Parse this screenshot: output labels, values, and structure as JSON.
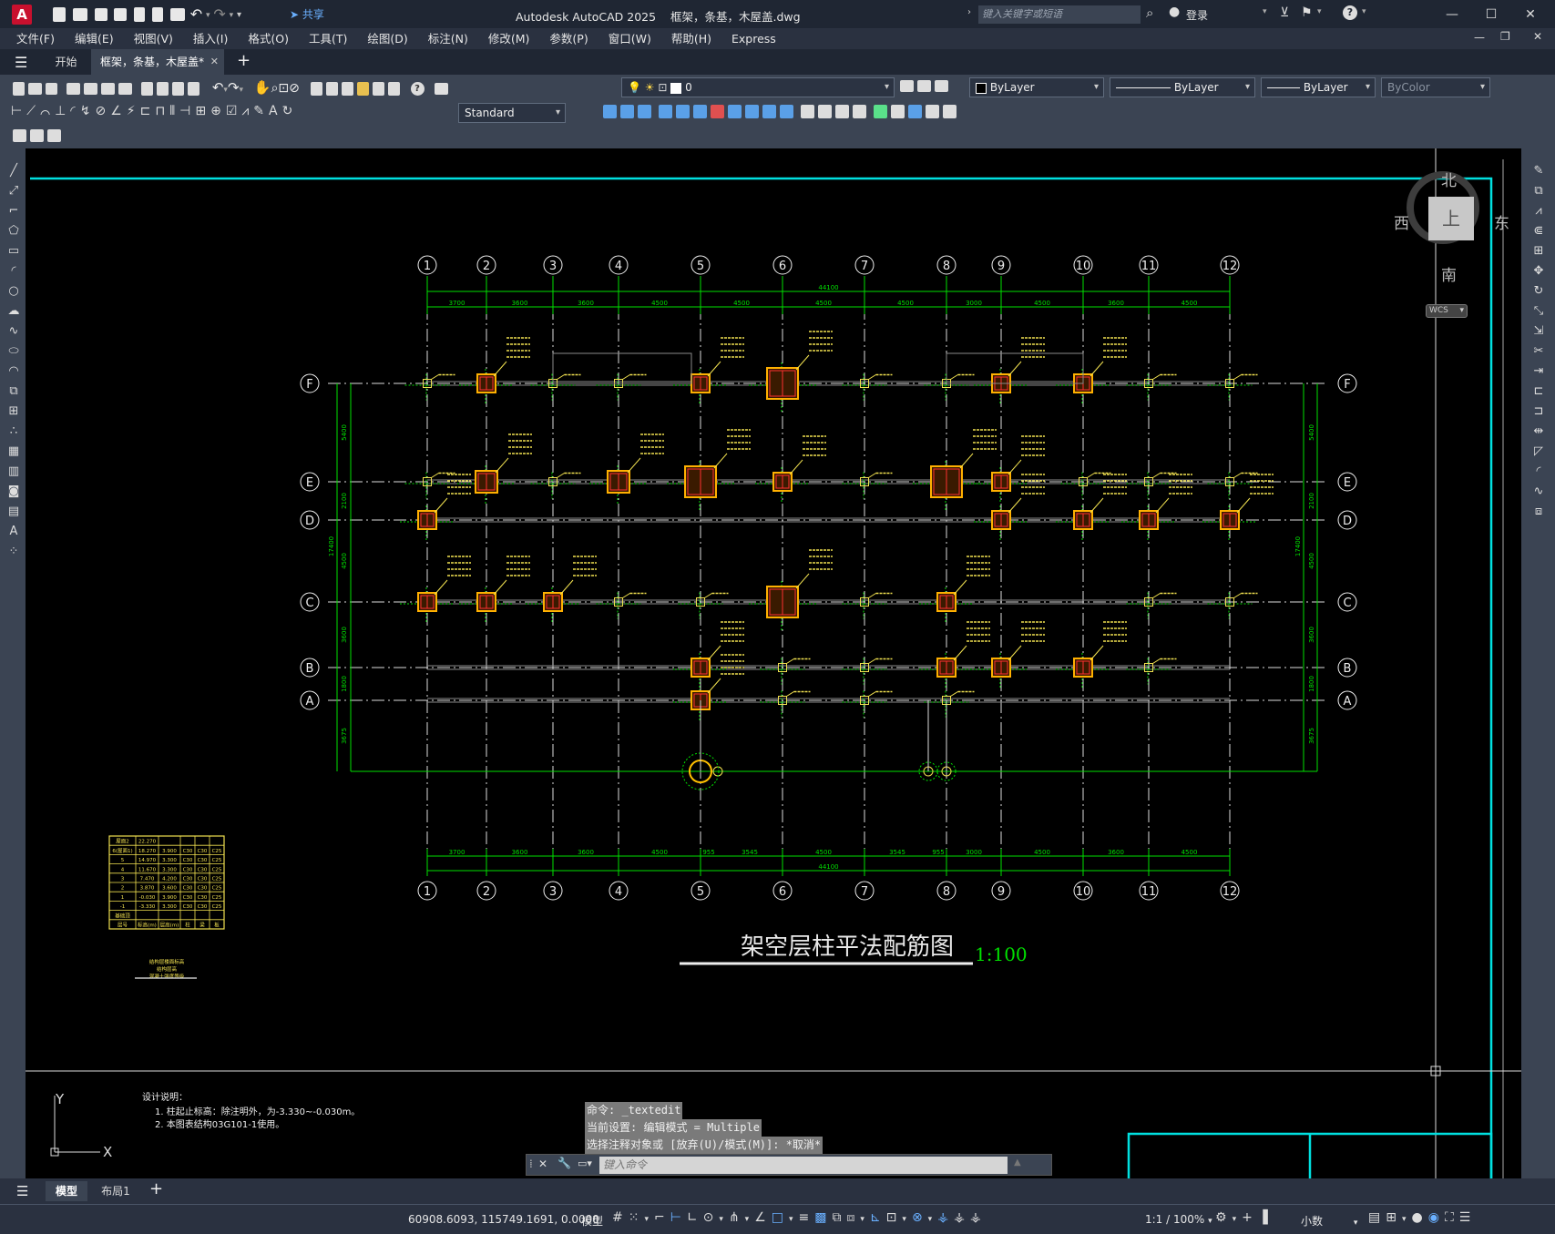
{
  "app": {
    "title": "Autodesk AutoCAD 2025    框架，条基，木屋盖.dwg",
    "search_placeholder": "键入关键字或短语",
    "login": "登录",
    "share": "共享",
    "logo": "A"
  },
  "menu": [
    "文件(F)",
    "编辑(E)",
    "视图(V)",
    "插入(I)",
    "格式(O)",
    "工具(T)",
    "绘图(D)",
    "标注(N)",
    "修改(M)",
    "参数(P)",
    "窗口(W)",
    "帮助(H)",
    "Express"
  ],
  "tabs": {
    "start": "开始",
    "active": "框架，条基，木屋盖*",
    "add": "+"
  },
  "toolbar": {
    "layer_value": "0",
    "color": "ByLayer",
    "linetype": "ByLayer",
    "lineweight": "ByLayer",
    "plotstyle": "ByColor",
    "dimstyle": "Standard"
  },
  "viewcube": {
    "north": "北",
    "south": "南",
    "east": "东",
    "west": "西",
    "face": "上",
    "wcs": "WCS"
  },
  "drawing": {
    "title": "架空层柱平法配筋图",
    "scale": "1:100",
    "grid_numbers": [
      "1",
      "2",
      "3",
      "4",
      "5",
      "6",
      "7",
      "8",
      "9",
      "10",
      "11",
      "12"
    ],
    "grid_letters": [
      "F",
      "E",
      "D",
      "C",
      "B",
      "A"
    ],
    "top_overall": "44100",
    "top_dims": [
      "3700",
      "3600",
      "3600",
      "4500",
      "4500",
      "4500",
      "4500",
      "3000",
      "4500",
      "3600",
      "4500"
    ],
    "bottom_dims": [
      "3700",
      "3600",
      "3600",
      "4500",
      "955",
      "3545",
      "4500",
      "3545",
      "955",
      "3000",
      "4500",
      "3600",
      "4500"
    ],
    "bottom_overall": "44100",
    "left_dims": [
      "5400",
      "2100",
      "4500",
      "3600",
      "1800",
      "3675"
    ],
    "left_overall": "17400",
    "notes_title": "设计说明：",
    "notes": [
      "1. 柱起止标高：除注明外，为-3.330~-0.030m。",
      "2. 本图表结构03G101-1使用。"
    ],
    "axis_y": "Y",
    "axis_x": "X"
  },
  "table": {
    "rows": [
      [
        "屋面2",
        "22.270",
        "",
        "",
        "",
        ""
      ],
      [
        "6(屋面1)",
        "18.270",
        "3.900",
        "C30",
        "C30",
        "C25"
      ],
      [
        "5",
        "14.970",
        "3.300",
        "C30",
        "C30",
        "C25"
      ],
      [
        "4",
        "11.670",
        "3.300",
        "C30",
        "C30",
        "C25"
      ],
      [
        "3",
        "7.470",
        "4.200",
        "C30",
        "C30",
        "C25"
      ],
      [
        "2",
        "3.870",
        "3.600",
        "C30",
        "C30",
        "C25"
      ],
      [
        "1",
        "-0.030",
        "3.900",
        "C30",
        "C30",
        "C25"
      ],
      [
        "-1",
        "-3.330",
        "3.300",
        "C30",
        "C30",
        "C25"
      ],
      [
        "基础顶",
        "",
        "",
        "",
        "",
        ""
      ],
      [
        "层号",
        "标高(m)",
        "层高(m)",
        "柱",
        "梁",
        "板"
      ]
    ],
    "caption": [
      "结构层楼面标高",
      "结构层高",
      "混凝土强度等级"
    ]
  },
  "command": {
    "lines": [
      "命令: _textedit",
      "当前设置: 编辑模式 = Multiple",
      "选择注释对象或 [放弃(U)/模式(M)]: *取消*"
    ],
    "placeholder": "键入命令"
  },
  "layouts": {
    "model": "模型",
    "layout1": "布局1",
    "add": "+"
  },
  "status": {
    "coords": "60908.6093, 115749.1691, 0.0000",
    "mode": "模型",
    "scale": "1:1 / 100%",
    "units": "小数"
  }
}
